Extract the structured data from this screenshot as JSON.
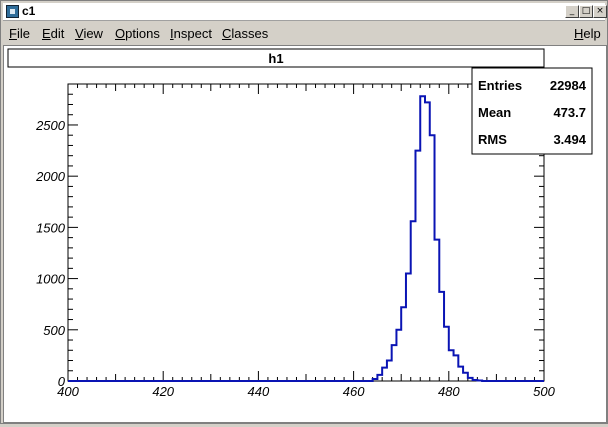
{
  "window": {
    "title": "c1",
    "controls": [
      "_",
      "□",
      "×"
    ]
  },
  "menu": {
    "items": [
      {
        "accel": "F",
        "rest": "ile"
      },
      {
        "accel": "E",
        "rest": "dit"
      },
      {
        "accel": "V",
        "rest": "iew"
      },
      {
        "accel": "O",
        "rest": "ptions"
      },
      {
        "accel": "I",
        "rest": "nspect"
      },
      {
        "accel": "C",
        "rest": "lasses"
      }
    ],
    "help": {
      "accel": "H",
      "rest": "elp"
    }
  },
  "colors": {
    "histogram": "#0a14b4",
    "axis": "#000000",
    "background": "#ffffff"
  },
  "chart_data": {
    "type": "bar",
    "title": "h1",
    "xlabel": "",
    "ylabel": "",
    "xlim": [
      400,
      500
    ],
    "ylim": [
      0,
      2900
    ],
    "xticks": [
      400,
      420,
      440,
      460,
      480,
      500
    ],
    "yticks": [
      0,
      500,
      1000,
      1500,
      2000,
      2500
    ],
    "bins": {
      "edges_start": 460,
      "width": 1,
      "values": [
        0,
        0,
        0,
        0,
        20,
        60,
        130,
        200,
        350,
        500,
        720,
        1050,
        1560,
        2250,
        2780,
        2720,
        2400,
        1380,
        870,
        530,
        300,
        250,
        140,
        80,
        30,
        10,
        5
      ]
    },
    "stats": {
      "entries_label": "Entries",
      "entries": "22984",
      "mean_label": "Mean",
      "mean": "473.7",
      "rms_label": "RMS",
      "rms": "3.494"
    }
  }
}
